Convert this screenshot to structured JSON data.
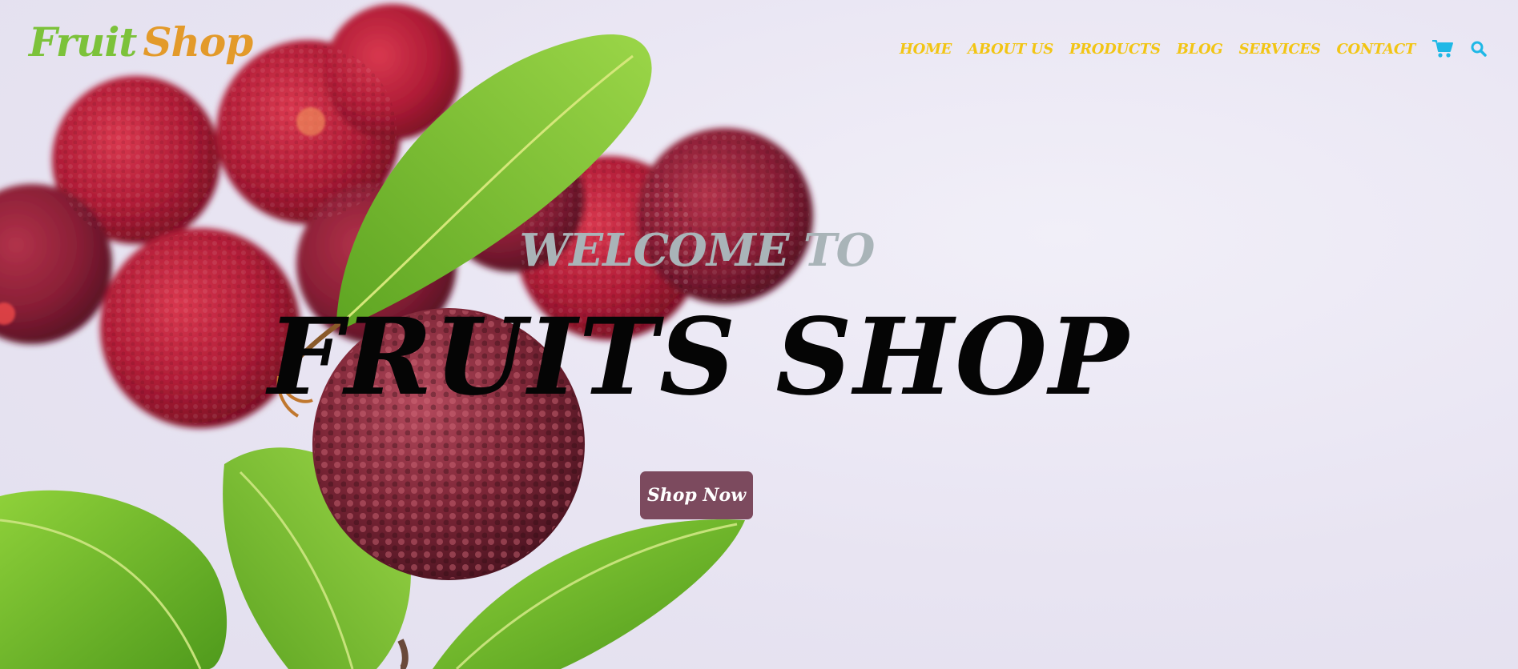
{
  "logo": {
    "part1": "Fruit",
    "part2": "Shop"
  },
  "nav": {
    "items": [
      {
        "label": "HOME"
      },
      {
        "label": "ABOUT US"
      },
      {
        "label": "PRODUCTS"
      },
      {
        "label": "BLOG"
      },
      {
        "label": "SERVICES"
      },
      {
        "label": "CONTACT"
      }
    ],
    "icons": [
      "cart-icon",
      "search-icon"
    ]
  },
  "hero": {
    "welcome": "WELCOME TO",
    "title": "FRUITS SHOP",
    "button_label": "Shop Now"
  },
  "colors": {
    "nav_text": "#f2c514",
    "nav_icons": "#1fb8e6",
    "logo_green": "#7cc23a",
    "logo_orange": "#e39a2a",
    "button_bg": "#7c4a5e",
    "welcome_text": "#a9b4b8",
    "title_text": "#050505"
  }
}
